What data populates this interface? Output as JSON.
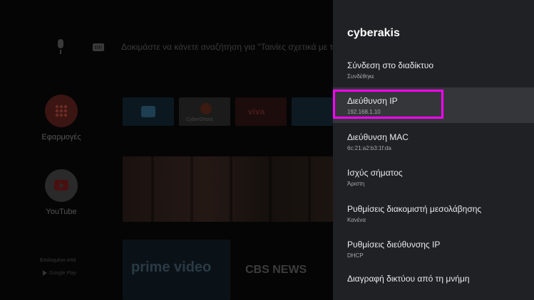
{
  "launcher": {
    "search_placeholder": "Δοκιμάστε να κάνετε αναζήτηση για \"Ταινίες σχετικά με το π",
    "apps_label": "Εφαρμογές",
    "youtube_label": "YouTube",
    "tiles": {
      "cyberghost": "CyberGhost",
      "viva": "viva",
      "prime": "prime video",
      "cbs": "CBS NEWS"
    },
    "sponsored_label": "Επιλεγμένο από",
    "google_play_label": "Google Play"
  },
  "panel": {
    "title": "cyberakis",
    "items": [
      {
        "label": "Σύνδεση στο διαδίκτυο",
        "value": "Συνδέθηκε"
      },
      {
        "label": "Διεύθυνση IP",
        "value": "192.168.1.10"
      },
      {
        "label": "Διεύθυνση MAC",
        "value": "6c:21:a2:b3:1f:da"
      },
      {
        "label": "Ισχύς σήματος",
        "value": "Άριστη"
      },
      {
        "label": "Ρυθμίσεις διακομιστή μεσολάβησης",
        "value": "Κανένα"
      },
      {
        "label": "Ρυθμίσεις διεύθυνσης IP",
        "value": "DHCP"
      },
      {
        "label": "Διαγραφή δικτύου από τη μνήμη",
        "value": ""
      }
    ],
    "focused_index": 1
  },
  "colors": {
    "panel_bg": "#202124",
    "focused_bg": "#35363a",
    "highlight": "#ff00ff"
  }
}
